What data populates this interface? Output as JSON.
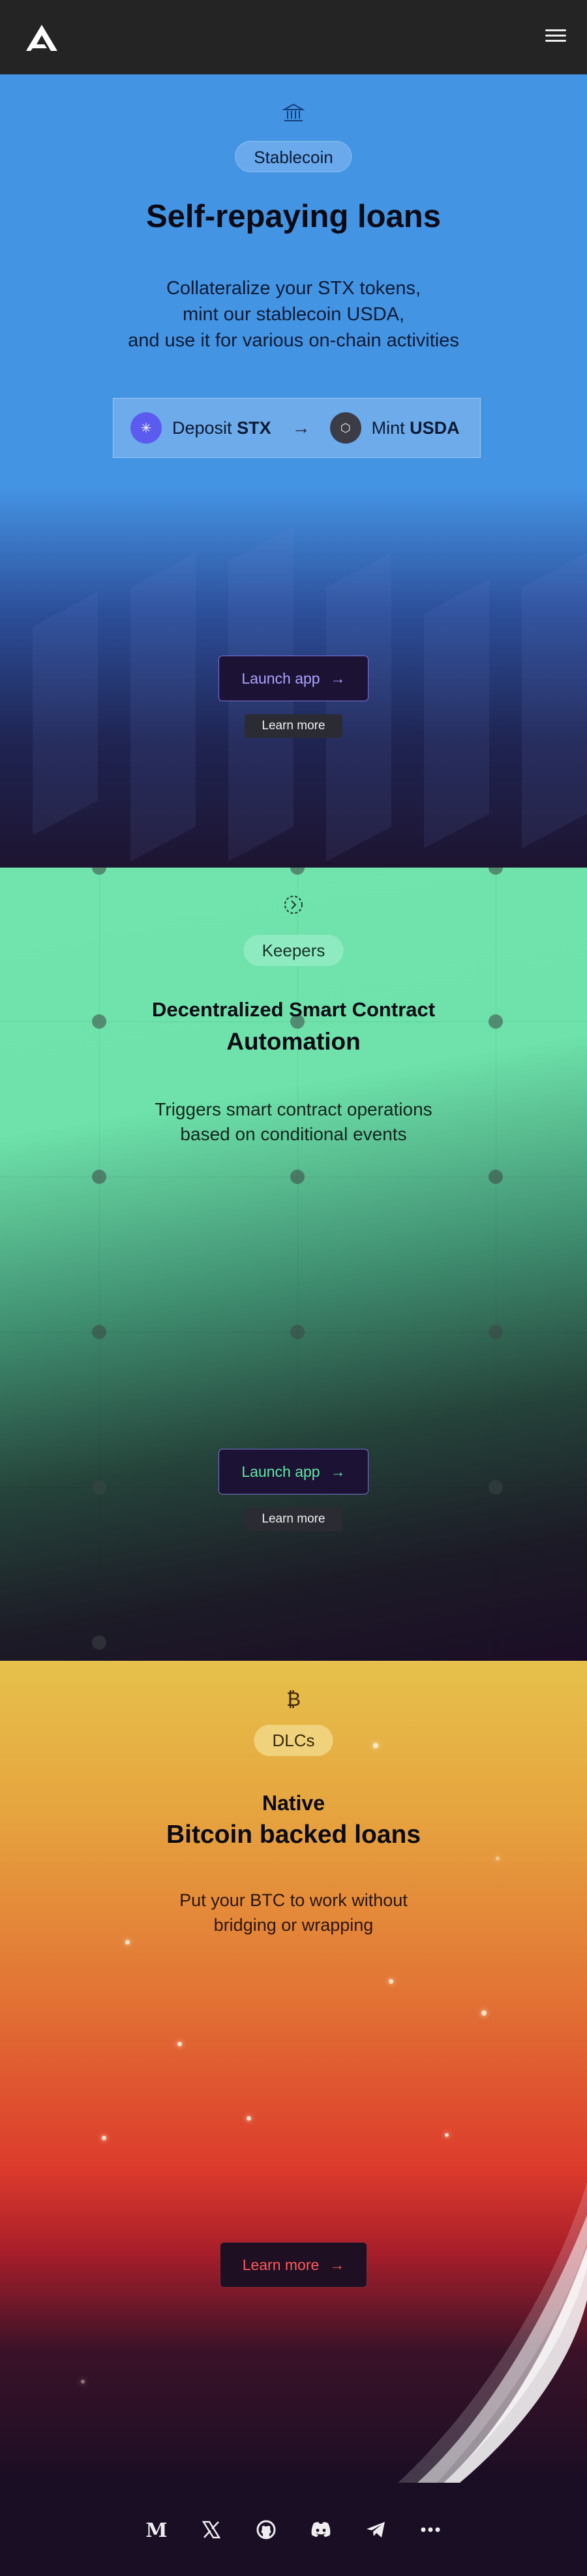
{
  "brand": {
    "logo": "arkadiko-logo"
  },
  "header": {
    "menu_icon": "hamburger-menu-icon"
  },
  "stablecoin": {
    "icon": "bank-icon",
    "pill": "Stablecoin",
    "title": "Self-repaying loans",
    "desc_line1": "Collateralize your STX tokens,",
    "desc_line2": "mint our stablecoin USDA,",
    "desc_line3": "and use it for various on-chain activities",
    "flow": {
      "step1_verb": "Deposit",
      "step1_token": "STX",
      "step2_verb": "Mint",
      "step2_token": "USDA",
      "arrow": "→"
    },
    "launch_label": "Launch app",
    "learn_label": "Learn more"
  },
  "keepers": {
    "icon": "automation-icon",
    "pill": "Keepers",
    "title_line1": "Decentralized Smart Contract",
    "title_line2": "Automation",
    "desc_line1": "Triggers smart contract operations",
    "desc_line2": "based on conditional events",
    "launch_label": "Launch app",
    "learn_label": "Learn more"
  },
  "dlcs": {
    "icon": "bitcoin-icon",
    "pill": "DLCs",
    "title_line1": "Native",
    "title_line2": "Bitcoin backed loans",
    "desc_line1": "Put your BTC to work without",
    "desc_line2": "bridging or wrapping",
    "learn_label": "Learn more"
  },
  "footer": {
    "socials": [
      "medium-icon",
      "x-icon",
      "github-icon",
      "discord-icon",
      "telegram-icon",
      "more-icon"
    ]
  },
  "colors": {
    "stablecoin_bg": "#4394e3",
    "keepers_bg": "#70e4ac",
    "dlcs_bg": "#e6c14b",
    "dark_bg": "#1a0e24",
    "header_bg": "#242424"
  }
}
